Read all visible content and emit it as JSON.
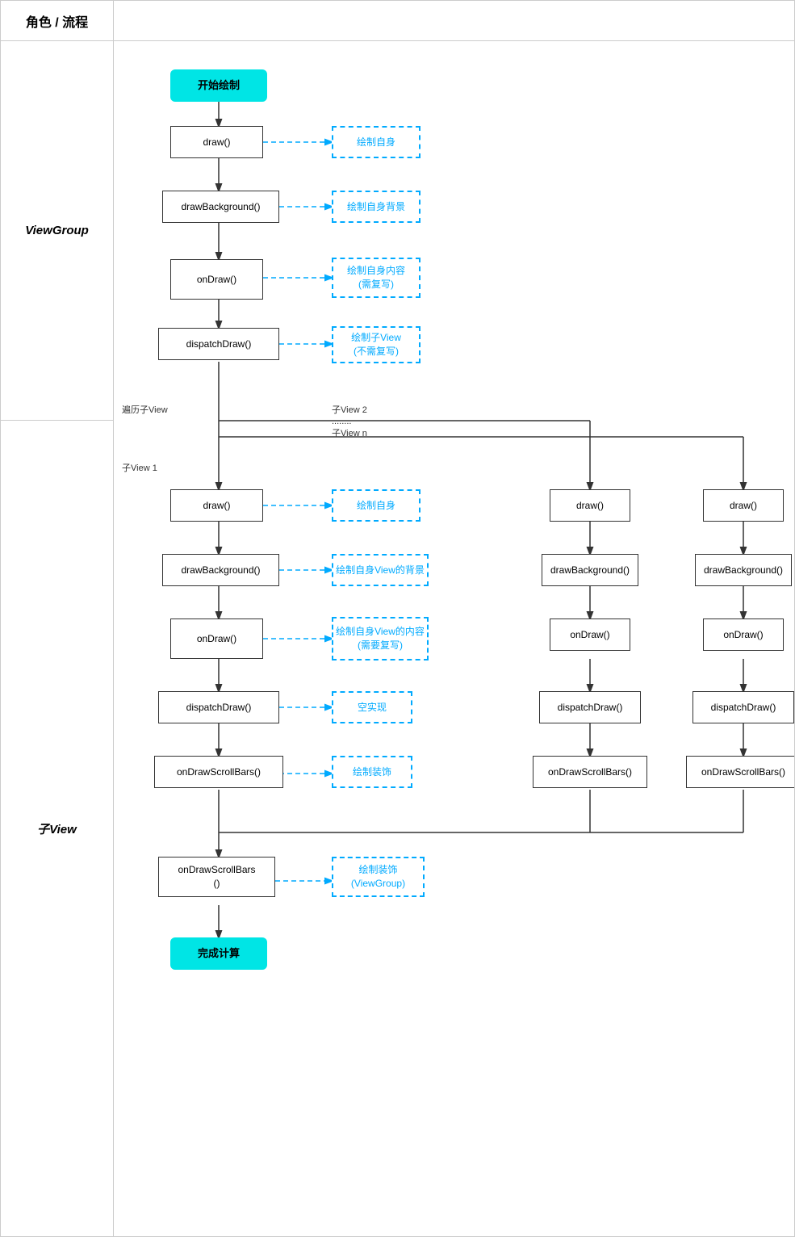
{
  "header": {
    "role_label": "角色 / 流程"
  },
  "sections": {
    "viewgroup_label": "ViewGroup",
    "childview_label": "子View"
  },
  "viewgroup_flow": {
    "start_box": "开始绘制",
    "draw_box": "draw()",
    "draw_note": "绘制自身",
    "drawBg_box": "drawBackground()",
    "drawBg_note": "绘制自身背景",
    "onDraw_box": "onDraw()",
    "onDraw_note": "绘制自身内容\n(需复写)",
    "dispatchDraw_box": "dispatchDraw()",
    "dispatchDraw_note": "绘制子View\n(不需复写)"
  },
  "traverse_labels": {
    "traverse": "遍历子View",
    "child2": "子View 2",
    "childN": "........\n子View n",
    "child1": "子View 1"
  },
  "child1_flow": {
    "draw": "draw()",
    "draw_note": "绘制自身",
    "drawBg": "drawBackground()",
    "drawBg_note": "绘制自身View的背景",
    "onDraw": "onDraw()",
    "onDraw_note": "绘制自身View的内容\n(需要复写)",
    "dispatchDraw": "dispatchDraw()",
    "dispatchDraw_note": "空实现",
    "onDrawScrollBars": "onDrawScrollBars()",
    "onDrawScrollBars_note": "绘制装饰"
  },
  "child2_flow": {
    "draw": "draw()",
    "drawBg": "drawBackground()",
    "onDraw": "onDraw()",
    "dispatchDraw": "dispatchDraw()",
    "onDrawScrollBars": "onDrawScrollBars()"
  },
  "childN_flow": {
    "draw": "draw()",
    "drawBg": "drawBackground()",
    "onDraw": "onDraw()",
    "dispatchDraw": "dispatchDraw()",
    "onDrawScrollBars": "onDrawScrollBars()"
  },
  "final_box": {
    "vg_onDrawScrollBars": "onDrawScrollBars\n()",
    "vg_note": "绘制装饰\n(ViewGroup)",
    "finish": "完成计算"
  }
}
